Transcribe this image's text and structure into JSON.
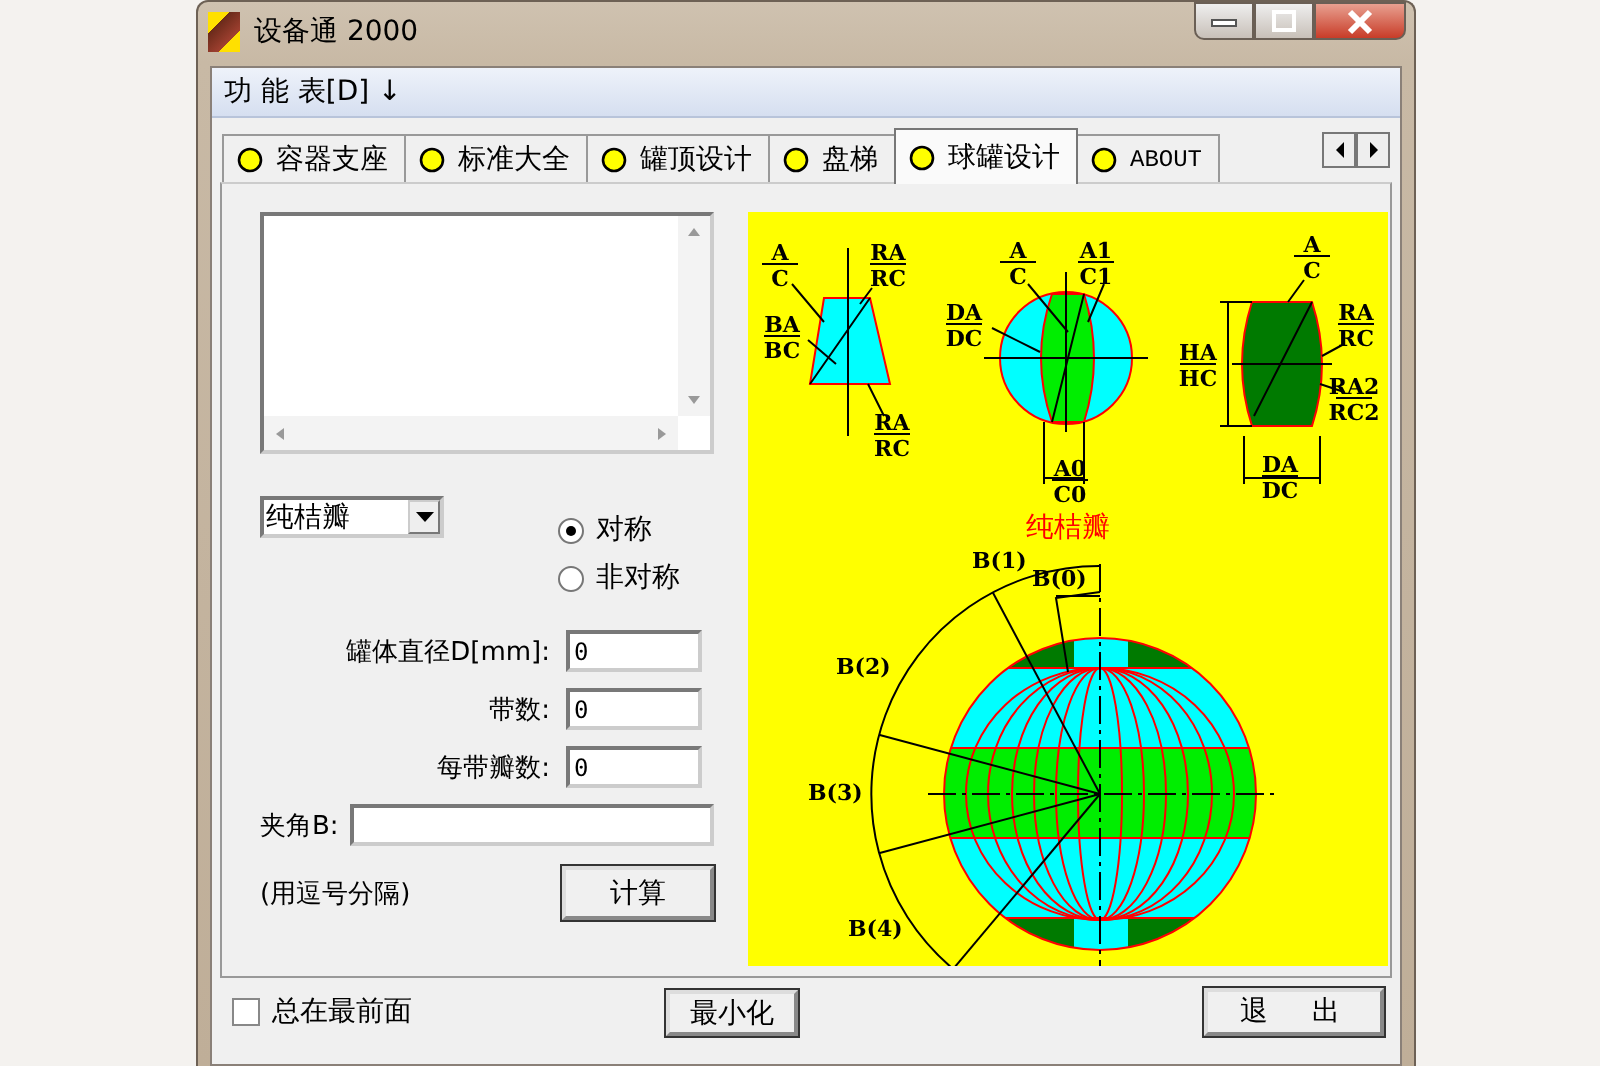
{
  "window": {
    "title": "设备通 2000"
  },
  "menu": [
    {
      "label": "功 能 表[D] ↓"
    }
  ],
  "tabs": [
    {
      "label": "容器支座",
      "selected": false
    },
    {
      "label": "标准大全",
      "selected": false
    },
    {
      "label": "罐顶设计",
      "selected": false
    },
    {
      "label": "盘梯",
      "selected": false
    },
    {
      "label": "球罐设计",
      "selected": true
    },
    {
      "label": "ABOUT",
      "selected": false
    }
  ],
  "dropdown": {
    "value": "纯桔瓣"
  },
  "radios": [
    {
      "label": "对称",
      "selected": true
    },
    {
      "label": "非对称",
      "selected": false
    }
  ],
  "fields": [
    {
      "label": "罐体直径D[mm]:",
      "value": "0",
      "kind": "short"
    },
    {
      "label": "带数:",
      "value": "0",
      "kind": "short"
    },
    {
      "label": "每带瓣数:",
      "value": "0",
      "kind": "short"
    },
    {
      "label": "夹角B:",
      "kind": "wide"
    }
  ],
  "note": "(用逗号分隔)",
  "calc_button": "计算",
  "diagram": {
    "title": "纯桔瓣",
    "fractions": [
      {
        "top": "A",
        "bottom": "C"
      },
      {
        "top": "RA",
        "bottom": "RC"
      },
      {
        "top": "BA",
        "bottom": "BC"
      },
      {
        "top": "RA",
        "bottom": "RC"
      },
      {
        "top": "A",
        "bottom": "C"
      },
      {
        "top": "A1",
        "bottom": "C1"
      },
      {
        "top": "DA",
        "bottom": "DC"
      },
      {
        "top": "A0",
        "bottom": "C0"
      },
      {
        "top": "A",
        "bottom": "C"
      },
      {
        "top": "HA",
        "bottom": "HC"
      },
      {
        "top": "RA",
        "bottom": "RC"
      },
      {
        "top": "RA2",
        "bottom": "RC2"
      },
      {
        "top": "DA",
        "bottom": "DC"
      }
    ],
    "angles": [
      "B(1)",
      "B(0)",
      "B(2)",
      "B(3)",
      "B(4)"
    ]
  },
  "always_on_top": {
    "label": "总在最前面",
    "checked": false
  },
  "buttons": [
    "最小化",
    "退　出"
  ]
}
